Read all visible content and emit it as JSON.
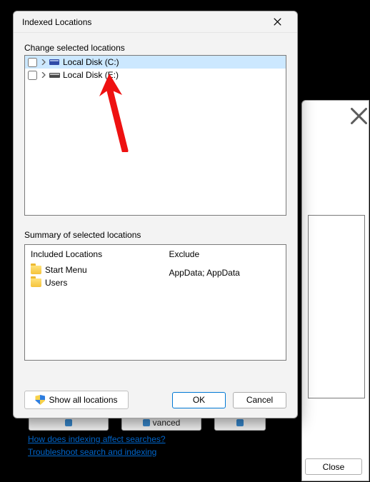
{
  "background": {
    "close_x": "✕",
    "close_button": "Close",
    "tab2_fragment": "vanced",
    "tab3_fragment": "",
    "link1": "How does indexing affect searches?",
    "link2": "Troubleshoot search and indexing"
  },
  "dialog": {
    "title": "Indexed Locations",
    "change_label": "Change selected locations",
    "tree": [
      {
        "label": "Local Disk (C:)",
        "selected": true,
        "icon": "ssd"
      },
      {
        "label": "Local Disk (E:)",
        "selected": false,
        "icon": "hdd"
      }
    ],
    "summary_label": "Summary of selected locations",
    "included_header": "Included Locations",
    "exclude_header": "Exclude",
    "included": [
      "Start Menu",
      "Users"
    ],
    "excluded": "AppData; AppData",
    "show_all": "Show all locations",
    "ok": "OK",
    "cancel": "Cancel"
  }
}
